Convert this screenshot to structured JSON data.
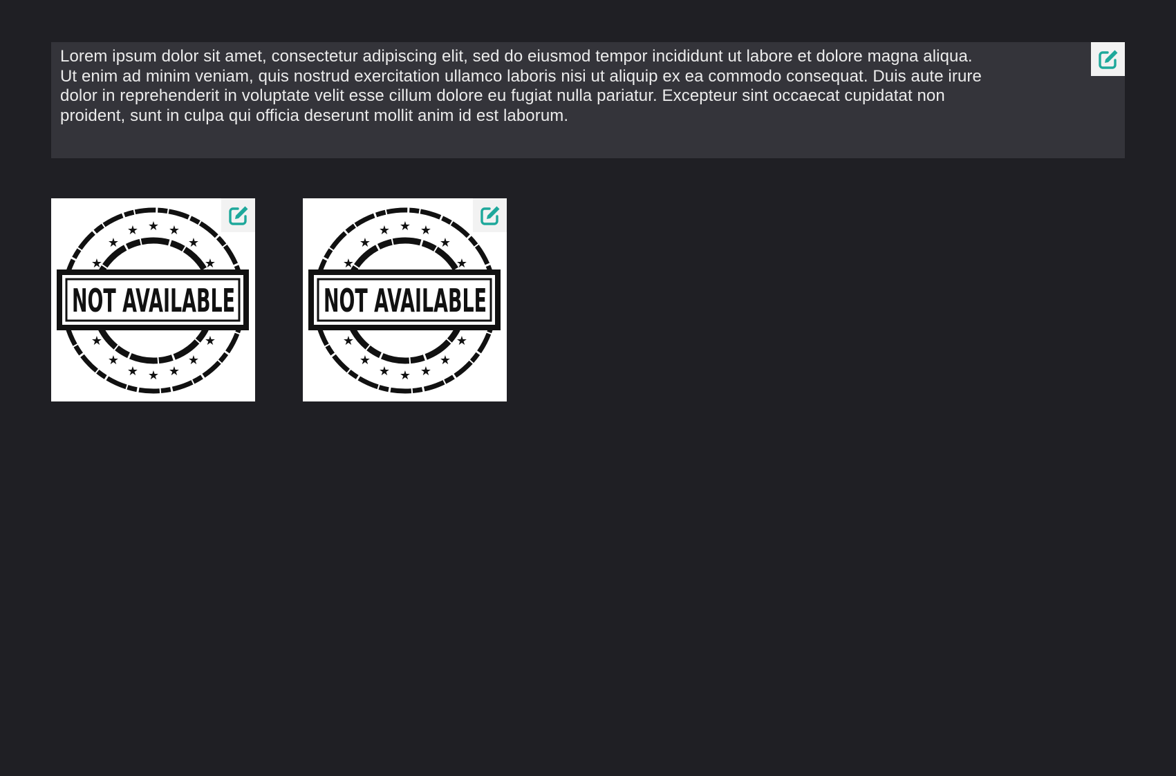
{
  "text_block": {
    "body": "Lorem ipsum dolor sit amet, consectetur adipiscing elit, sed do eiusmod tempor incididunt ut labore et dolore magna aliqua.\nUt enim ad minim veniam, quis nostrud exercitation ullamco laboris nisi ut aliquip ex ea commodo consequat. Duis aute irure\ndolor in reprehenderit in voluptate velit esse cillum dolore eu fugiat nulla pariatur. Excepteur sint occaecat cupidatat non\nproident, sunt in culpa qui officia deserunt mollit anim id est laborum.",
    "edit_icon": "edit-icon"
  },
  "images": [
    {
      "stamp_text": "NOT AVAILABLE",
      "edit_icon": "edit-icon"
    },
    {
      "stamp_text": "NOT AVAILABLE",
      "edit_icon": "edit-icon"
    }
  ],
  "colors": {
    "background": "#1f1f24",
    "panel": "#34343a",
    "text": "#ececec",
    "accent": "#1ea89b",
    "edit_button_bg": "#f2f2f2"
  }
}
